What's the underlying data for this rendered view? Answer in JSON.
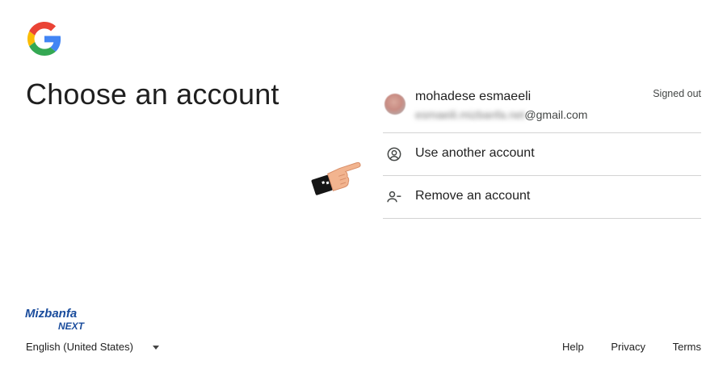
{
  "page": {
    "title": "Choose an account"
  },
  "account": {
    "name": "mohadese esmaeeli",
    "email_hidden": "esmaeili.mizbanfa.net",
    "email_domain": "@gmail.com",
    "status": "Signed out"
  },
  "options": {
    "use_another": "Use another account",
    "remove": "Remove an account"
  },
  "icons": {
    "use_another": "account-circle-icon",
    "remove": "person-remove-icon",
    "hand": "pointing-hand-icon"
  },
  "brand": {
    "line1": "Mizbanfa",
    "line2": "NEXT"
  },
  "footer": {
    "language": "English (United States)",
    "help": "Help",
    "privacy": "Privacy",
    "terms": "Terms"
  },
  "colors": {
    "blue": "#4285F4",
    "red": "#EA4335",
    "yellow": "#FBBC05",
    "green": "#34A853",
    "brand_blue": "#1a4c9c"
  }
}
